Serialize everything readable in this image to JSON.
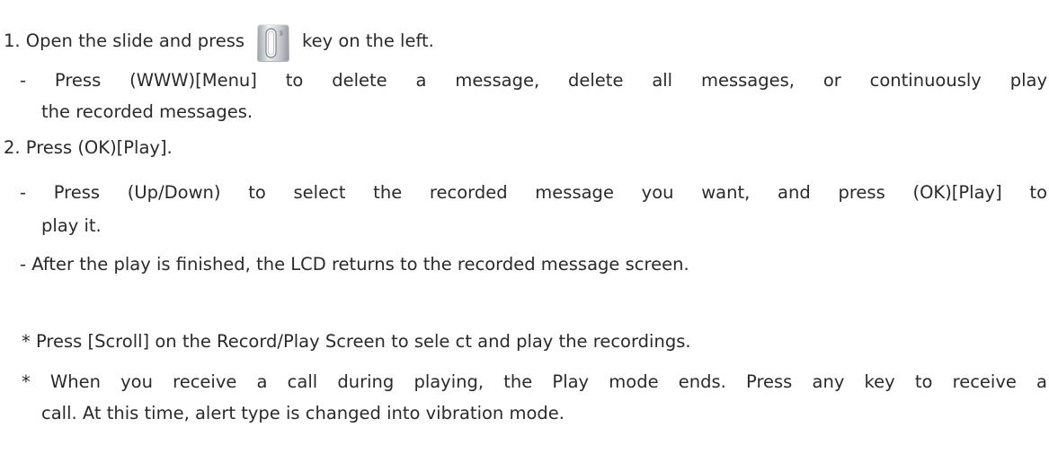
{
  "steps": [
    {
      "before_icon": "1. Open the slide and press",
      "icon": "side-key-icon",
      "after_icon": "key on the left."
    }
  ],
  "step1_sub": {
    "line_a": "- Press (WWW)[Menu] to delete a message, delete all messages, or continuously play",
    "line_b": "the recorded messages."
  },
  "step2": {
    "title": "2. Press (OK)[Play].",
    "sub1_a": "- Press (Up/Down) to select the recorded message you want, and press (OK)[Play] to",
    "sub1_b": "play it.",
    "sub2": "- After the play is finished, the LCD returns to the recorded message screen."
  },
  "notes": {
    "note1": "* Press [Scroll] on the Record/Play Screen to sele ct and play the recordings.",
    "note2_a": "* When you receive a call during playing, the Play mode ends. Press any key to receive a",
    "note2_b": "call. At this time, alert type is changed into vibration mode."
  }
}
